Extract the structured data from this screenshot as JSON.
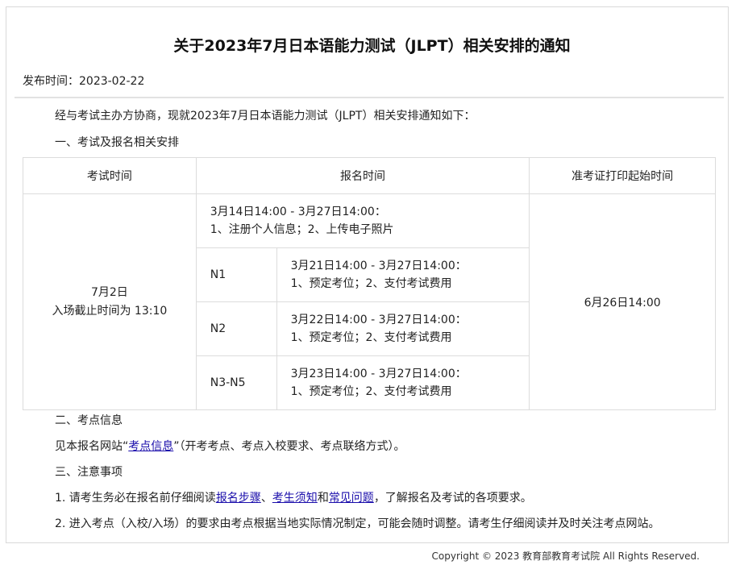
{
  "title": "关于2023年7月日本语能力测试（JLPT）相关安排的通知",
  "publish_time": "发布时间：2023-02-22",
  "intro": "经与考试主办方协商，现就2023年7月日本语能力测试（JLPT）相关安排通知如下：",
  "section1_heading": "一、考试及报名相关安排",
  "table": {
    "headers": [
      "考试时间",
      "报名时间",
      "准考证打印起始时间"
    ],
    "exam_date": "7月2日",
    "exam_cutoff": "入场截止时间为 13:10",
    "reg_common_time": "3月14日14:00 - 3月27日14:00：",
    "reg_common_steps": "1、注册个人信息；2、上传电子照片",
    "levels": [
      {
        "level": "N1",
        "time": "3月21日14:00 - 3月27日14:00：",
        "steps": "1、预定考位；2、支付考试费用"
      },
      {
        "level": "N2",
        "time": "3月22日14:00 - 3月27日14:00：",
        "steps": "1、预定考位；2、支付考试费用"
      },
      {
        "level": "N3-N5",
        "time": "3月23日14:00 - 3月27日14:00：",
        "steps": "1、预定考位；2、支付考试费用"
      }
    ],
    "admit_print_time": "6月26日14:00"
  },
  "section2_heading": "二、考点信息",
  "venue": {
    "prefix": "见本报名网站“",
    "link": "考点信息",
    "suffix": "”（开考考点、考点入校要求、考点联络方式）。"
  },
  "section3_heading": "三、注意事项",
  "note1": {
    "prefix": "1. 请考生务必在报名前仔细阅读",
    "link1": "报名步骤",
    "sep1": "、",
    "link2": "考生须知",
    "sep2": "和",
    "link3": "常见问题",
    "suffix": "，了解报名及考试的各项要求。"
  },
  "note2": "2. 进入考点（入校/入场）的要求由考点根据当地实际情况制定，可能会随时调整。请考生仔细阅读并及时关注考点网站。",
  "footer": "Copyright © 2023 教育部教育考试院 All Rights Reserved."
}
